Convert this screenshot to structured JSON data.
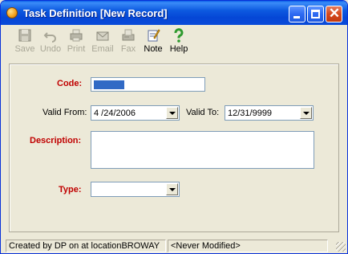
{
  "window": {
    "title": "Task Definition [New Record]"
  },
  "toolbar": {
    "items": [
      {
        "label": "Save",
        "icon": "save-icon",
        "enabled": false
      },
      {
        "label": "Undo",
        "icon": "undo-icon",
        "enabled": false
      },
      {
        "label": "Print",
        "icon": "print-icon",
        "enabled": false
      },
      {
        "label": "Email",
        "icon": "email-icon",
        "enabled": false
      },
      {
        "label": "Fax",
        "icon": "fax-icon",
        "enabled": false
      },
      {
        "label": "Note",
        "icon": "note-icon",
        "enabled": true
      },
      {
        "label": "Help",
        "icon": "help-icon",
        "enabled": true
      }
    ]
  },
  "form": {
    "code_label": "Code:",
    "code_value": "",
    "valid_from_label": "Valid From:",
    "valid_from_value": "4 /24/2006",
    "valid_to_label": "Valid To:",
    "valid_to_value": "12/31/9999",
    "description_label": "Description:",
    "description_value": "",
    "type_label": "Type:",
    "type_value": ""
  },
  "status": {
    "created": "Created by DP on  at locationBROWAY",
    "modified": "<Never Modified>"
  },
  "colors": {
    "required_label": "#c00000",
    "titlebar": "#0a4bd9",
    "selection": "#316ac5"
  }
}
